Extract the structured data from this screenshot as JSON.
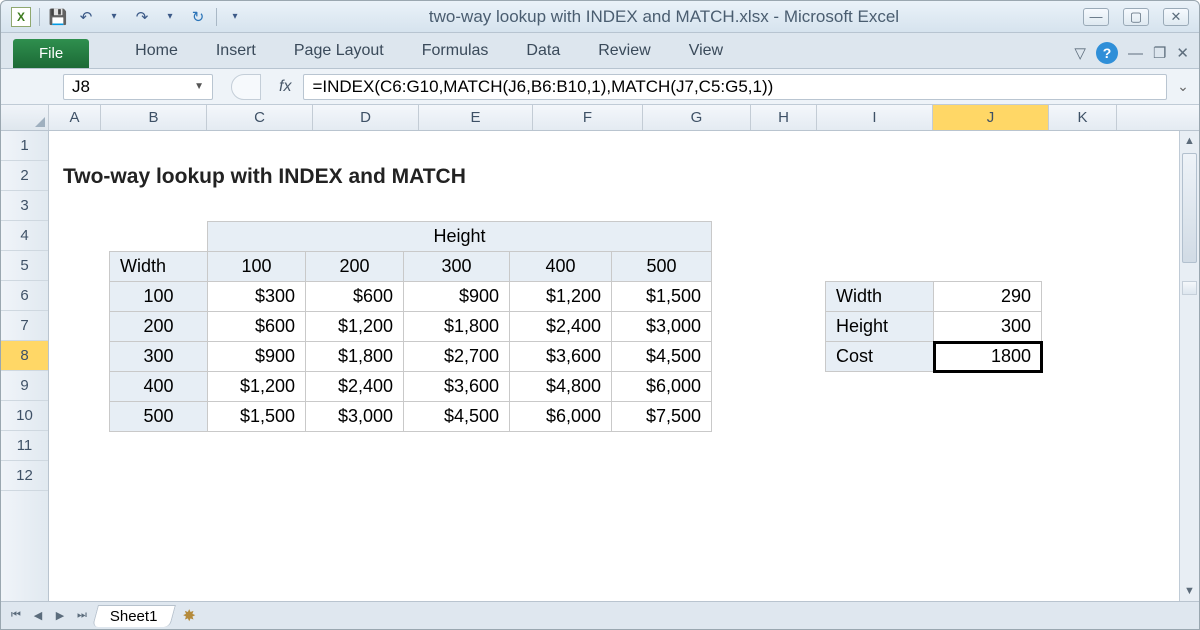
{
  "title": "two-way lookup with INDEX and MATCH.xlsx  -  Microsoft Excel",
  "tabs": {
    "file": "File",
    "home": "Home",
    "insert": "Insert",
    "page_layout": "Page Layout",
    "formulas": "Formulas",
    "data": "Data",
    "review": "Review",
    "view": "View"
  },
  "namebox": "J8",
  "formula": "=INDEX(C6:G10,MATCH(J6,B6:B10,1),MATCH(J7,C5:G5,1))",
  "columns": [
    "A",
    "B",
    "C",
    "D",
    "E",
    "F",
    "G",
    "H",
    "I",
    "J",
    "K"
  ],
  "active_column": "J",
  "rows": [
    "1",
    "2",
    "3",
    "4",
    "5",
    "6",
    "7",
    "8",
    "9",
    "10",
    "11",
    "12"
  ],
  "active_row": "8",
  "sheet_title": "Two-way lookup with INDEX and MATCH",
  "main_table": {
    "corner_label": "Width",
    "height_label": "Height",
    "col_heads": [
      "100",
      "200",
      "300",
      "400",
      "500"
    ],
    "row_heads": [
      "100",
      "200",
      "300",
      "400",
      "500"
    ],
    "rows": [
      [
        "$300",
        "$600",
        "$900",
        "$1,200",
        "$1,500"
      ],
      [
        "$600",
        "$1,200",
        "$1,800",
        "$2,400",
        "$3,000"
      ],
      [
        "$900",
        "$1,800",
        "$2,700",
        "$3,600",
        "$4,500"
      ],
      [
        "$1,200",
        "$2,400",
        "$3,600",
        "$4,800",
        "$6,000"
      ],
      [
        "$1,500",
        "$3,000",
        "$4,500",
        "$6,000",
        "$7,500"
      ]
    ]
  },
  "lookup": {
    "width_label": "Width",
    "width_value": "290",
    "height_label": "Height",
    "height_value": "300",
    "cost_label": "Cost",
    "cost_value": "1800"
  },
  "sheet_tab": "Sheet1",
  "excel_mark": "X"
}
